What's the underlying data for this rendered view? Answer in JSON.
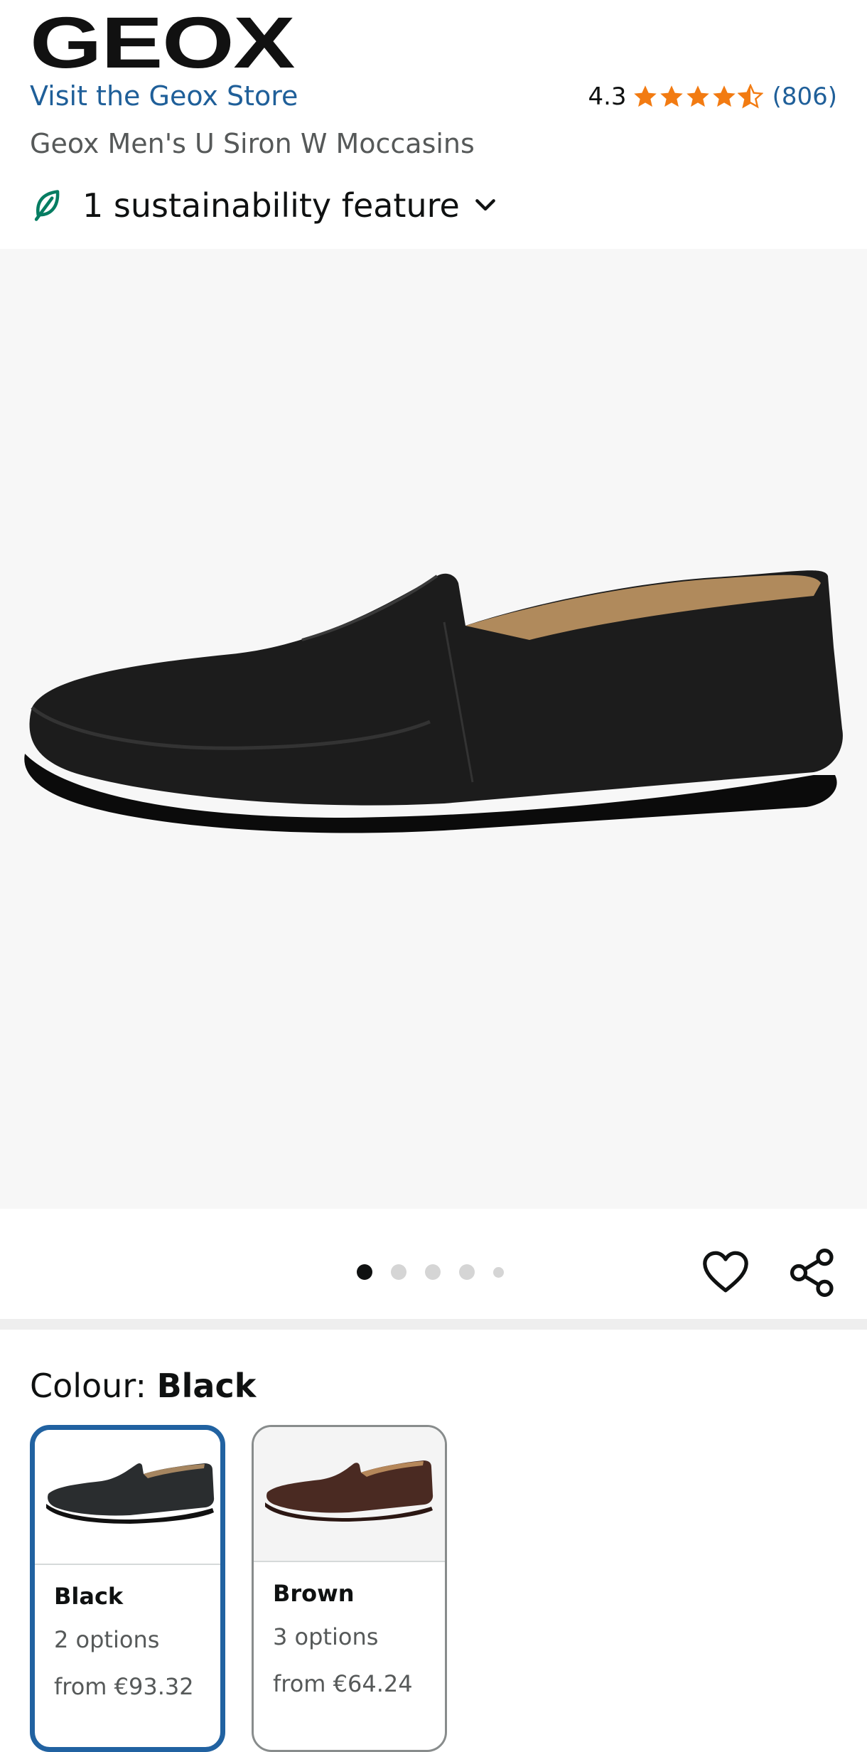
{
  "header": {
    "brand_logo": "GEOX",
    "store_link": "Visit the Geox Store",
    "rating_value": "4.3",
    "review_count": "(806)",
    "product_title": "Geox Men's U Siron W Moccasins",
    "sustainability": "1 sustainability feature"
  },
  "rating": {
    "stars_filled": 4.3,
    "stars_total": 5,
    "star_color": "#f27b12"
  },
  "carousel": {
    "total_images": 5,
    "current_index": 0
  },
  "colour": {
    "label": "Colour: ",
    "selected": "Black",
    "swatches": [
      {
        "name": "Black",
        "options": "2 options",
        "price": "from €93.32"
      },
      {
        "name": "Brown",
        "options": "3 options",
        "price": "from €64.24"
      }
    ]
  },
  "colors": {
    "link": "#1f5f99",
    "selected_border": "#2162a1",
    "leaf": "#067d62"
  }
}
